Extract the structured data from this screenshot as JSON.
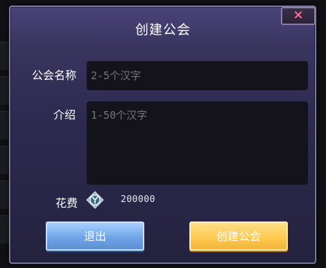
{
  "dialog": {
    "title": "创建公会",
    "close_label": "×"
  },
  "form": {
    "name_label": "公会名称",
    "name_placeholder": "2-5个汉字",
    "intro_label": "介绍",
    "intro_placeholder": "1-50个汉字",
    "cost_label": "花费",
    "cost_icon": "crystal-coin-icon",
    "cost_value": "200000"
  },
  "buttons": {
    "exit_label": "退出",
    "create_label": "创建公会"
  },
  "colors": {
    "dialog_bg": "#2d2a50",
    "close_x": "#ff6c8a",
    "exit_button": "#6fa6e8",
    "create_button": "#ffcb52"
  }
}
